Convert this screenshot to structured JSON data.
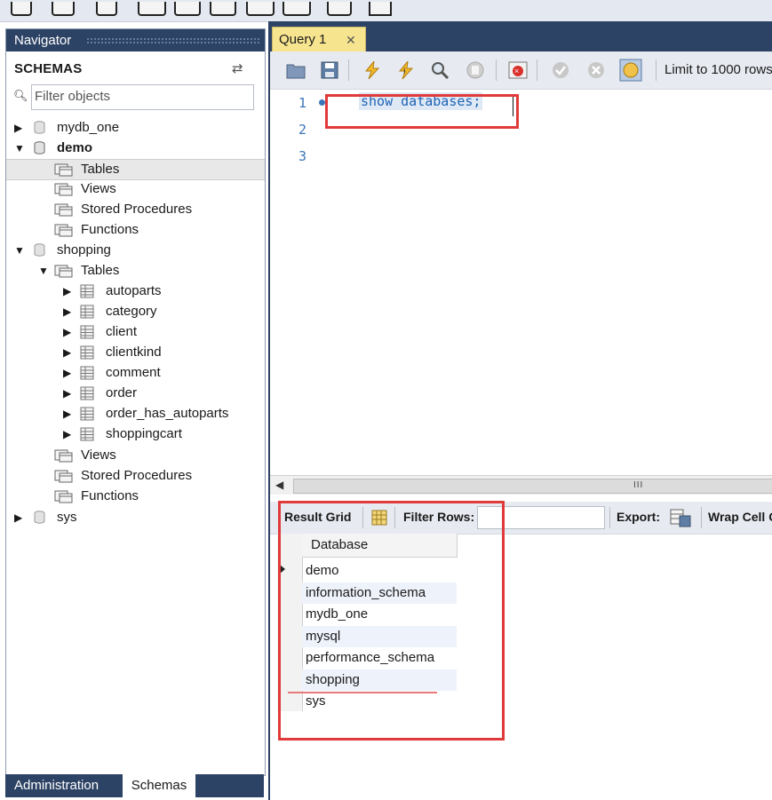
{
  "navigator": {
    "title": "Navigator",
    "schemas_title": "SCHEMAS",
    "filter_placeholder": "Filter objects",
    "tree": {
      "mydb_one": "mydb_one",
      "demo": "demo",
      "demo_tables": "Tables",
      "demo_views": "Views",
      "demo_procs": "Stored Procedures",
      "demo_functions": "Functions",
      "shopping": "shopping",
      "shopping_tables": "Tables",
      "tables": [
        "autoparts",
        "category",
        "client",
        "clientkind",
        "comment",
        "order",
        "order_has_autoparts",
        "shoppingcart"
      ],
      "shopping_views": "Views",
      "shopping_procs": "Stored Procedures",
      "shopping_functions": "Functions",
      "sys": "sys"
    },
    "bottom_tabs": {
      "administration": "Administration",
      "schemas": "Schemas"
    }
  },
  "query_tab": {
    "label": "Query 1",
    "close": "✕"
  },
  "editor_toolbar": {
    "limit_label": "Limit to 1000 rows"
  },
  "editor": {
    "line_numbers": [
      "1",
      "2",
      "3"
    ],
    "sql": "show databases;"
  },
  "scrollbar": {
    "grip": "III"
  },
  "results": {
    "result_grid_label": "Result Grid",
    "filter_rows_label": "Filter Rows:",
    "export_label": "Export:",
    "wrap_label": "Wrap Cell C",
    "column_header": "Database",
    "rows": [
      "demo",
      "information_schema",
      "mydb_one",
      "mysql",
      "performance_schema",
      "shopping",
      "sys"
    ]
  },
  "colors": {
    "navy": "#2d4365",
    "highlight_red": "#e03a3a",
    "tab_yellow": "#f7e48f",
    "sql_blue": "#1f63b5"
  }
}
